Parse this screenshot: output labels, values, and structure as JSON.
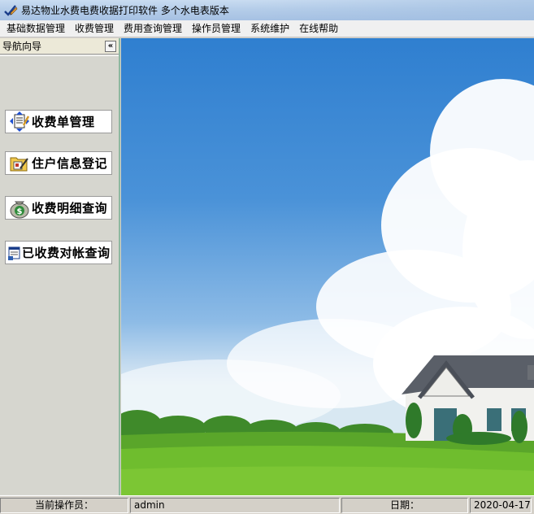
{
  "window": {
    "title": "易达物业水费电费收据打印软件  多个水电表版本",
    "app_icon": "pencil-check-icon"
  },
  "menu": {
    "items": [
      "基础数据管理",
      "收费管理",
      "费用查询管理",
      "操作员管理",
      "系统维护",
      "在线帮助"
    ]
  },
  "nav": {
    "title": "导航向导",
    "collapse_label": "«",
    "buttons": [
      {
        "label": "收费单管理",
        "icon": "document-arrows-icon"
      },
      {
        "label": "住户信息登记",
        "icon": "folder-edit-icon"
      },
      {
        "label": "收费明细查询",
        "icon": "money-bag-icon"
      },
      {
        "label": "已收费对帐查询",
        "icon": "document-window-icon"
      }
    ]
  },
  "status": {
    "operator_label": "当前操作员：",
    "operator_value": "admin",
    "date_label": "日期：",
    "date_value": "2020-04-17"
  }
}
